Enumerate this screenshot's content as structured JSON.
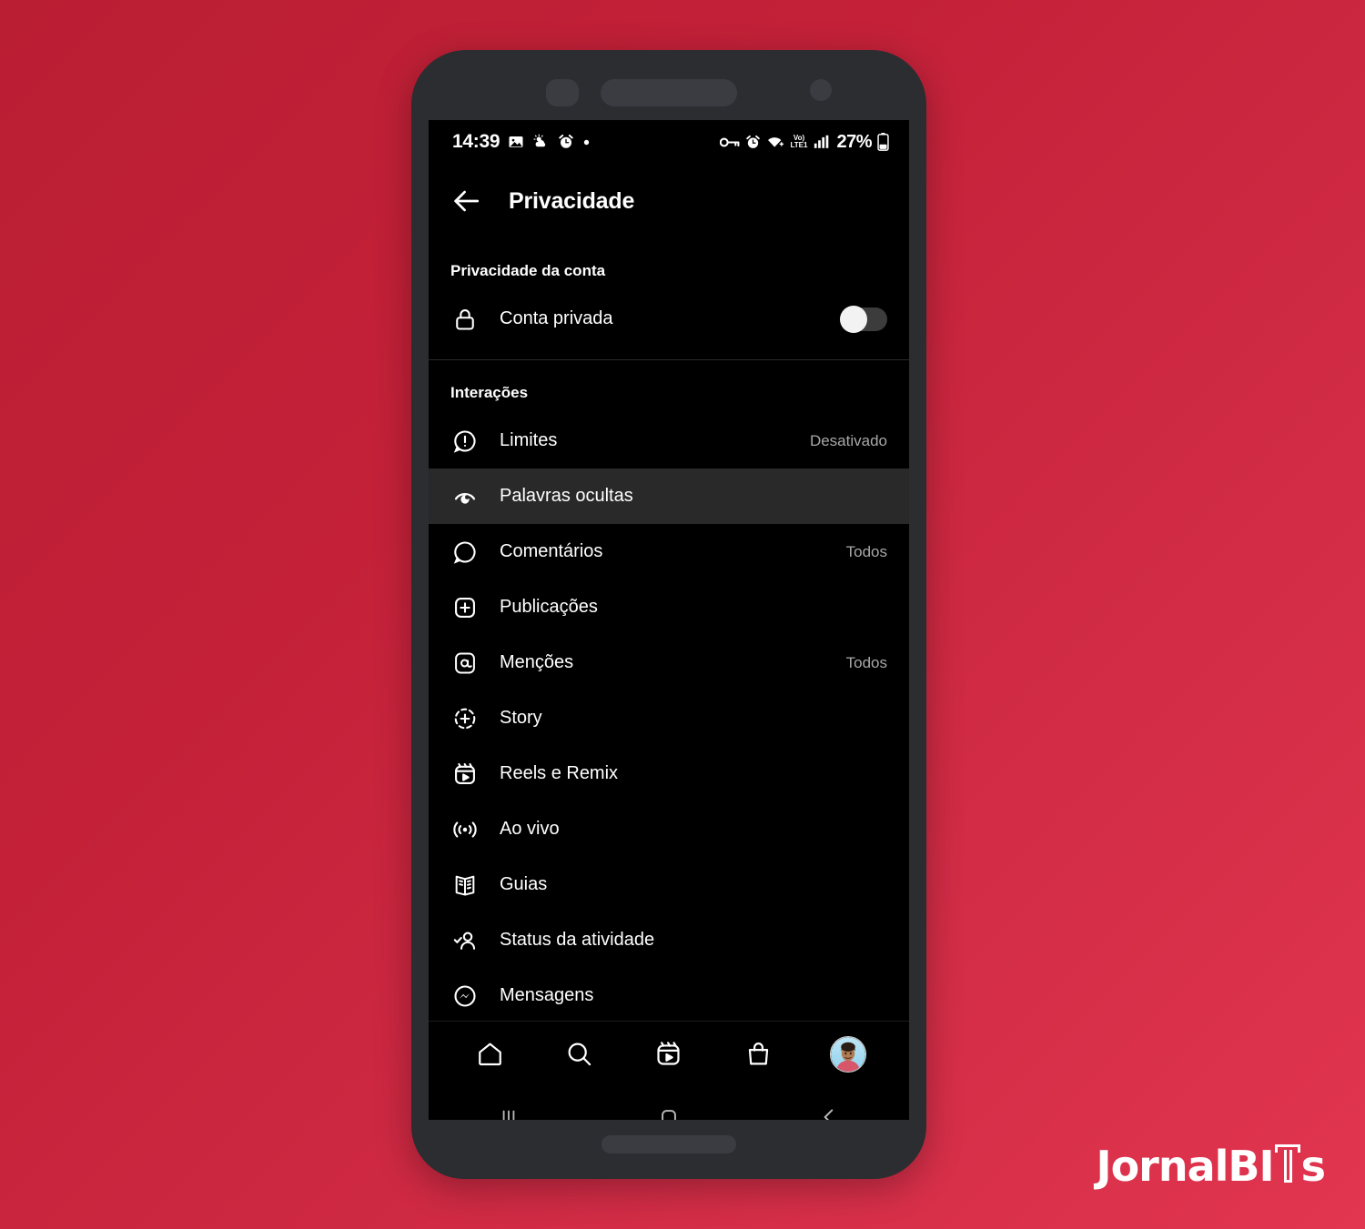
{
  "theme": {
    "background_start": "#ba1e33",
    "background_end": "#e2354f",
    "screen_bg": "#000000",
    "highlight_bg": "#292929",
    "text_primary": "#ffffff",
    "text_secondary": "#a8a8a8"
  },
  "status_bar": {
    "clock": "14:39",
    "battery_percent": "27%",
    "network_label_top": "Vo)",
    "network_label_bottom": "LTE1",
    "left_icons": [
      "image-icon",
      "weather-icon",
      "alarm-clock-icon",
      "dot-icon"
    ],
    "right_icons": [
      "vpn-key-icon",
      "alarm-icon",
      "wifi-icon",
      "volte-icon",
      "signal-bars-icon",
      "battery-icon"
    ]
  },
  "appbar": {
    "back_label": "back-arrow",
    "title": "Privacidade"
  },
  "sections": [
    {
      "header": "Privacidade da conta",
      "rows": [
        {
          "icon": "lock-icon",
          "label": "Conta privada",
          "value": "",
          "control": "toggle",
          "toggle_on": false,
          "highlight": false
        }
      ]
    },
    {
      "header": "Interações",
      "rows": [
        {
          "icon": "limits-bubble-icon",
          "label": "Limites",
          "value": "Desativado",
          "control": "none",
          "highlight": false
        },
        {
          "icon": "hidden-words-icon",
          "label": "Palavras ocultas",
          "value": "",
          "control": "none",
          "highlight": true
        },
        {
          "icon": "comment-bubble-icon",
          "label": "Comentários",
          "value": "Todos",
          "control": "none",
          "highlight": false
        },
        {
          "icon": "plus-square-icon",
          "label": "Publicações",
          "value": "",
          "control": "none",
          "highlight": false
        },
        {
          "icon": "mention-at-icon",
          "label": "Menções",
          "value": "Todos",
          "control": "none",
          "highlight": false
        },
        {
          "icon": "story-plus-icon",
          "label": "Story",
          "value": "",
          "control": "none",
          "highlight": false
        },
        {
          "icon": "reels-icon",
          "label": "Reels e Remix",
          "value": "",
          "control": "none",
          "highlight": false
        },
        {
          "icon": "live-broadcast-icon",
          "label": "Ao vivo",
          "value": "",
          "control": "none",
          "highlight": false
        },
        {
          "icon": "guides-book-icon",
          "label": "Guias",
          "value": "",
          "control": "none",
          "highlight": false
        },
        {
          "icon": "activity-status-icon",
          "label": "Status da atividade",
          "value": "",
          "control": "none",
          "highlight": false
        },
        {
          "icon": "messenger-icon",
          "label": "Mensagens",
          "value": "",
          "control": "none",
          "highlight": false
        }
      ]
    }
  ],
  "tabbar": {
    "items": [
      {
        "icon": "home-icon",
        "name": "tab-home"
      },
      {
        "icon": "search-icon",
        "name": "tab-search"
      },
      {
        "icon": "reels-icon",
        "name": "tab-reels"
      },
      {
        "icon": "shop-bag-icon",
        "name": "tab-shop"
      },
      {
        "icon": "avatar",
        "name": "tab-profile"
      }
    ]
  },
  "navbar": {
    "items": [
      {
        "icon": "recents-icon",
        "name": "android-recents"
      },
      {
        "icon": "home-square-icon",
        "name": "android-home"
      },
      {
        "icon": "back-chevron-icon",
        "name": "android-back"
      }
    ]
  },
  "watermark": {
    "part1": "JornalBI",
    "part2": "T",
    "part3": "s"
  }
}
